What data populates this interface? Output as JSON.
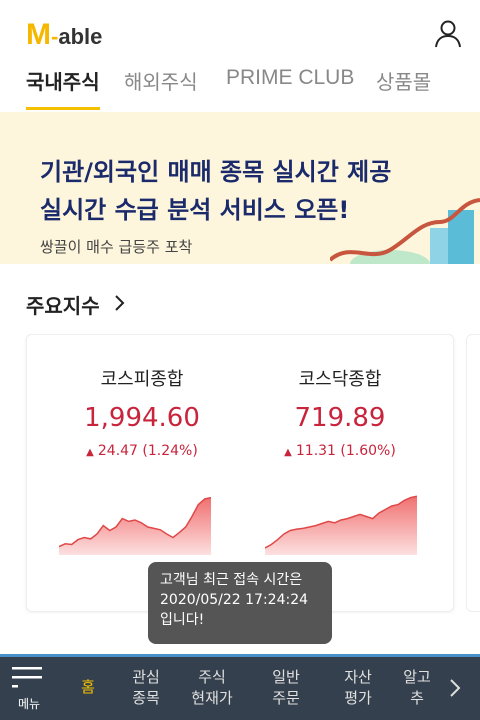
{
  "header": {
    "logo_m": "M",
    "logo_dash": "-",
    "logo_rest": "able",
    "brand_color": "#f5b700",
    "user_icon": "user-icon"
  },
  "tabs": [
    {
      "label": "국내주식",
      "active": true
    },
    {
      "label": "해외주식",
      "active": false
    },
    {
      "label": "PRIME CLUB",
      "active": false
    },
    {
      "label": "상품몰",
      "active": false
    }
  ],
  "banner": {
    "title_line1": "기관/외국인 매매 종목 실시간 제공",
    "title_line2": "실시간 수급 분석 서비스 오픈!",
    "subtitle": "쌍끌이 매수 급등주 포착"
  },
  "indices_section": {
    "title": "주요지수",
    "chevron_icon": "chevron-right-icon",
    "items": [
      {
        "name": "코스피종합",
        "value": "1,994.60",
        "change": "24.47 (1.24%)",
        "direction": "up",
        "trend": [
          0.12,
          0.16,
          0.15,
          0.22,
          0.25,
          0.23,
          0.3,
          0.42,
          0.35,
          0.4,
          0.52,
          0.48,
          0.5,
          0.46,
          0.4,
          0.38,
          0.36,
          0.3,
          0.25,
          0.32,
          0.4,
          0.55,
          0.72,
          0.8,
          0.82
        ]
      },
      {
        "name": "코스닥종합",
        "value": "719.89",
        "change": "11.31 (1.60%)",
        "direction": "up",
        "trend": [
          0.1,
          0.15,
          0.22,
          0.3,
          0.35,
          0.37,
          0.38,
          0.4,
          0.42,
          0.45,
          0.48,
          0.46,
          0.5,
          0.52,
          0.55,
          0.58,
          0.55,
          0.52,
          0.6,
          0.65,
          0.7,
          0.72,
          0.78,
          0.82,
          0.84
        ]
      }
    ],
    "up_color": "#c8243c"
  },
  "toast": {
    "line1": "고객님 최근 접속 시간은",
    "line2": "2020/05/22 17:24:24",
    "line3": "입니다!"
  },
  "bottom_nav": {
    "menu_label": "메뉴",
    "items": [
      {
        "line1": "홈",
        "line2": "",
        "active": true
      },
      {
        "line1": "관심",
        "line2": "종목",
        "active": false
      },
      {
        "line1": "주식",
        "line2": "현재가",
        "active": false
      },
      {
        "line1": "일반",
        "line2": "주문",
        "active": false
      },
      {
        "line1": "자산",
        "line2": "평가",
        "active": false
      },
      {
        "line1": "알고",
        "line2": "추",
        "active": false
      }
    ],
    "next_icon": "chevron-right-icon",
    "accent": "#4a90c8"
  }
}
